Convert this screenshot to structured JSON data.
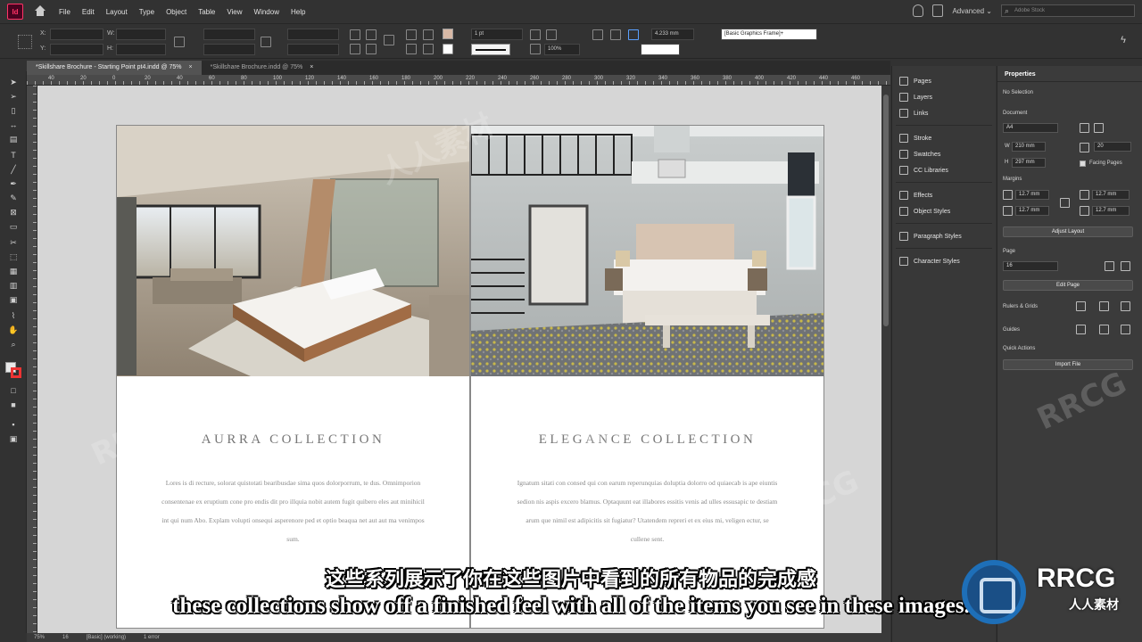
{
  "menubar": {
    "app_logo": "Id",
    "items": [
      "File",
      "Edit",
      "Layout",
      "Type",
      "Object",
      "Table",
      "View",
      "Window",
      "Help"
    ],
    "workspace": "Advanced",
    "stock_search_placeholder": "Adobe Stock"
  },
  "controlbar": {
    "x_label": "X:",
    "y_label": "Y:",
    "w_label": "W:",
    "h_label": "H:",
    "stroke_weight": "1 pt",
    "opacity": "100%",
    "measure": "4.233 mm",
    "object_style": "[Basic Graphics Frame]+"
  },
  "tabs": [
    {
      "label": "*Skillshare Brochure - Starting Point pt4.indd @ 75%",
      "close": "×"
    },
    {
      "label": "*Skillshare Brochure.indd @ 75%",
      "close": "×"
    }
  ],
  "ruler_labels": [
    "40",
    "20",
    "0",
    "20",
    "40",
    "60",
    "80",
    "100",
    "120",
    "140",
    "160",
    "180",
    "200",
    "220",
    "240",
    "260",
    "280",
    "300",
    "320",
    "340",
    "360",
    "380",
    "400",
    "420",
    "440",
    "460",
    "480",
    "500"
  ],
  "pages": {
    "left": {
      "title": "AURRA COLLECTION",
      "body": "Lores is di recture, solorat quistotati bearibusdae sima quos dolorporrum, te dus. Omnimporion consentenae ex eruptium cone pro endis dit pro illquia nobit autem fugit quibero eles aut minihicil int qui num Abo. Explam volupti onsequi asperenore ped et optio beaqua net aut aut ma venimpos sum."
    },
    "right": {
      "title": "ELEGANCE COLLECTION",
      "body": "Ignatum sitati con consed qui con earum reperunquias doluptia dolorro od quiaecab is ape eiuntis sedion nis aspis excero blamus. Optaquunt eat illabores essitis venis ad ulles essusapic te destiam arum que nimil est adipicitis sit fugiatur? Utatendem repreri et ex eius mi, veligen ectur, se cullene sent."
    }
  },
  "statusbar": {
    "zoom": "75%",
    "page": "16",
    "style": "[Basic] (working)",
    "preflight": "1 error"
  },
  "dock": {
    "items": [
      "Pages",
      "Layers",
      "Links",
      "Stroke",
      "Swatches",
      "CC Libraries",
      "Effects",
      "Object Styles",
      "Paragraph Styles",
      "Character Styles"
    ]
  },
  "properties": {
    "tab": "Properties",
    "selection": "No Selection",
    "document_label": "Document",
    "page_size": "A4",
    "w_label": "W",
    "h_label": "H",
    "width": "210 mm",
    "height": "297 mm",
    "pages_count": "20",
    "facing_pages": "Facing Pages",
    "margins_label": "Margins",
    "margin_top": "12.7 mm",
    "margin_bottom": "12.7 mm",
    "margin_left": "12.7 mm",
    "margin_right": "12.7 mm",
    "adjust_layout": "Adjust Layout",
    "page_label": "Page",
    "page_value": "16",
    "edit_page": "Edit Page",
    "rulers_grids": "Rulers & Grids",
    "guides": "Guides",
    "quick_actions": "Quick Actions",
    "import_file": "Import File"
  },
  "subtitles": {
    "cn": "这些系列展示了你在这些图片中看到的所有物品的完成感",
    "en": "these collections show off a finished feel with all of the items you see in these images."
  },
  "watermark": {
    "brand": "RRCG",
    "cn": "人人素材"
  },
  "colors": {
    "accent_fill": "#d8b9a6",
    "app_accent": "#ff3366",
    "brand_blue": "#1e6fb8"
  }
}
